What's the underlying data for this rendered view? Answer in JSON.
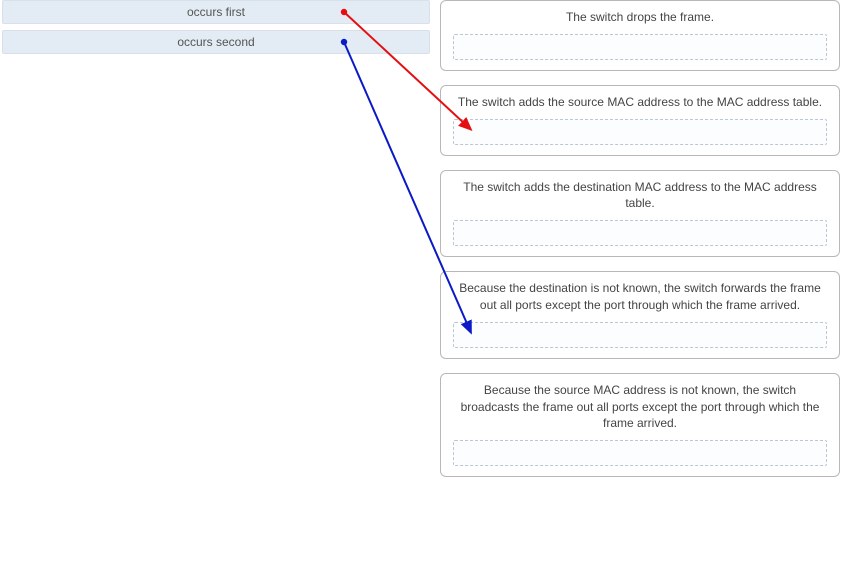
{
  "left_items": [
    {
      "label": "occurs first"
    },
    {
      "label": "occurs second"
    }
  ],
  "targets": [
    {
      "label": "The switch drops the frame."
    },
    {
      "label": "The switch adds the source MAC address to the MAC address table."
    },
    {
      "label": "The switch adds the destination MAC address to the MAC address table."
    },
    {
      "label": "Because the destination is not known, the switch forwards the frame out all ports except the port through which the frame arrived."
    },
    {
      "label": "Because the source MAC address is not known, the switch broadcasts the frame out all ports except the port through which the frame arrived."
    }
  ],
  "arrows": [
    {
      "from_item": 0,
      "to_target": 1,
      "color": "#e40f13"
    },
    {
      "from_item": 1,
      "to_target": 3,
      "color": "#0b19c6"
    }
  ]
}
